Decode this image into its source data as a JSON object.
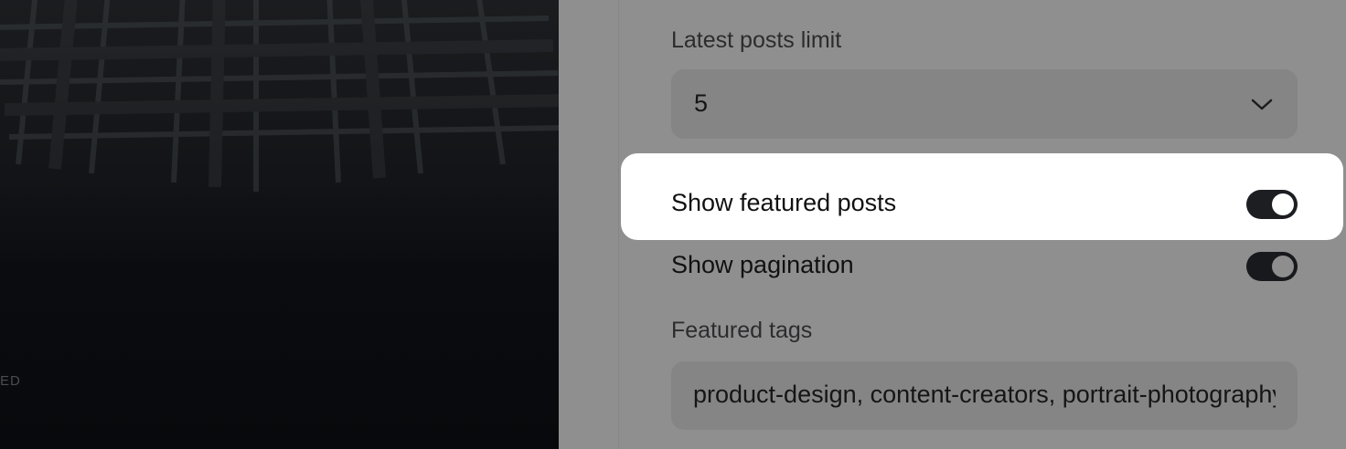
{
  "preview": {
    "caption": "ED"
  },
  "settings": {
    "latest_posts_limit": {
      "label": "Latest posts limit",
      "value": "5"
    },
    "show_featured_posts": {
      "label": "Show featured posts",
      "enabled": true
    },
    "show_pagination": {
      "label": "Show pagination",
      "enabled": true
    },
    "featured_tags": {
      "label": "Featured tags",
      "value": "product-design, content-creators, portrait-photography"
    }
  },
  "colors": {
    "overlay": "#8e8e8e",
    "toggle_on": "#1c1e22",
    "highlight": "#ffffff"
  },
  "icons": {
    "select_chevron": "chevron-down-icon"
  }
}
